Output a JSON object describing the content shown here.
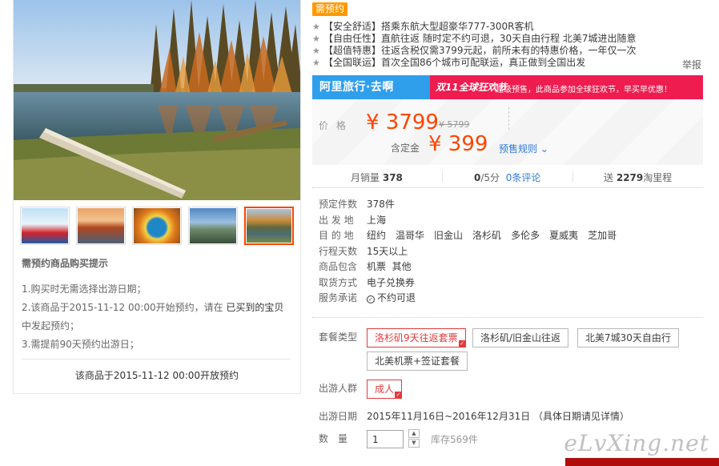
{
  "left": {
    "thumbnails": [
      {
        "name": "thumb-airplane-ad",
        "active": false
      },
      {
        "name": "thumb-golden-gate",
        "active": false
      },
      {
        "name": "thumb-hot-spring",
        "active": false
      },
      {
        "name": "thumb-statue-of-liberty",
        "active": false
      },
      {
        "name": "thumb-lake-forest",
        "active": true
      }
    ],
    "tips": {
      "title": "需预约商品购买提示",
      "line1": "1.购买时无需选择出游日期；",
      "line2_prefix": "2.该商品于2015-11-12 00:00开始预约，请在",
      "line2_em": "已买到的宝贝",
      "line2_suffix": "中发起预约；",
      "line3": "3.需提前90天预约出游日；"
    },
    "open_note": "该商品于2015-11-12 00:00开放预约"
  },
  "right": {
    "preorder_tag": "需预约",
    "features": [
      "【安全舒适】搭乘东航大型超豪华777-300R客机",
      "【自由任性】直航往返 随时定不约可退，30天自由行程 北美7城进出随意",
      "【超值特惠】往返含税仅需3799元起，前所未有的特惠价格，一年仅一次",
      "【全国联运】首次全国86个城市可配联运，真正做到全国出发"
    ],
    "report": "举报",
    "brand": "阿里旅行·去啊",
    "promo_logo": "双11全球狂欢节",
    "promo_text": "超级预售，此商品参加全球狂欢节，早买早优惠！",
    "price": {
      "label": "价格",
      "main": "¥ 3799",
      "original": "¥ 5799",
      "deposit_label": "含定金",
      "deposit": "¥ 399",
      "rule": "预售规则"
    },
    "stats": {
      "monthly_label": "月销量",
      "monthly_value": "378",
      "rating_value": "0",
      "rating_suffix": "/5分",
      "reviews": "0条评论",
      "points_prefix": "送",
      "points_value": "2279",
      "points_suffix": "淘里程"
    },
    "details": {
      "booked_label": "预定件数",
      "booked_value": "378件",
      "depart_label": "出 发 地",
      "depart_value": "上海",
      "dest_label": "目 的 地",
      "dest_cities": [
        "纽约",
        "温哥华",
        "旧金山",
        "洛杉矶",
        "多伦多",
        "夏威夷",
        "芝加哥"
      ],
      "days_label": "行程天数",
      "days_value": "15天以上",
      "includes_label": "商品包含",
      "includes_value": "机票  其他",
      "pickup_label": "取货方式",
      "pickup_value": "电子兑换券",
      "promise_label": "服务承诺",
      "promise_value": "不约可退"
    },
    "package": {
      "label": "套餐类型",
      "options": [
        "洛杉矶9天往返套票",
        "洛杉矶/旧金山往返",
        "北美7城30天自由行",
        "北美机票+签证套餐"
      ],
      "selected": "洛杉矶9天往返套票"
    },
    "crowd": {
      "label": "出游人群",
      "option": "成人"
    },
    "date": {
      "label": "出游日期",
      "value": "2015年11月16日~2016年12月31日 （具体日期请见详情）"
    },
    "quantity": {
      "label": "数量",
      "value": "1",
      "stock": "库存569件"
    }
  },
  "watermark": "eLvXing.net",
  "colors": {
    "accent_orange": "#ff4400",
    "tag_orange": "#ff9900",
    "brand_blue": "#2f9fec",
    "promo_red": "#ee1c4f",
    "link_blue": "#2f7bd9",
    "select_red": "#e4393c"
  }
}
